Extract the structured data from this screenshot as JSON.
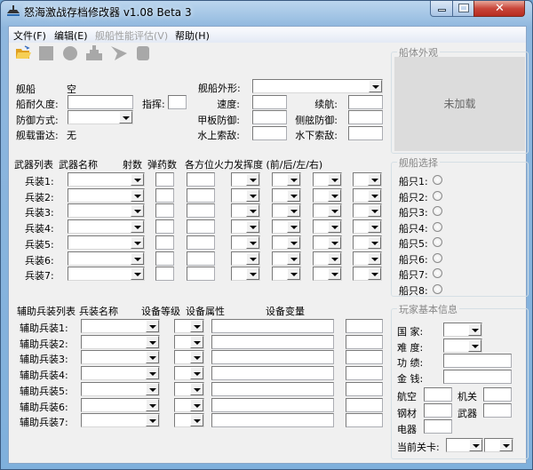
{
  "window": {
    "title": "怒海激战存档修改器 v1.08 Beta 3"
  },
  "menu": [
    {
      "label": "文件(F)",
      "enabled": true
    },
    {
      "label": "编辑(E)",
      "enabled": true
    },
    {
      "label": "舰船性能评估(V)",
      "enabled": false
    },
    {
      "label": "帮助(H)",
      "enabled": true
    }
  ],
  "toolbar": [
    "open-folder-icon",
    "square-icon",
    "circle-icon",
    "ship-icon",
    "plane-icon",
    "rounded-square-icon"
  ],
  "ship": {
    "ship_label": "舰船",
    "ship_value": "空",
    "durability_label": "船耐久度:",
    "command_label": "指挥:",
    "defense_mode_label": "防御方式:",
    "radar_label": "舰载雷达:",
    "radar_value": "无",
    "shape_label": "舰船外形:",
    "speed_label": "速度:",
    "range_label": "续航:",
    "deck_def_label": "甲板防御:",
    "side_def_label": "侧舷防御:",
    "surface_scan_label": "水上索敌:",
    "underwater_scan_label": "水下索敌:"
  },
  "weapons": {
    "headers": {
      "list": "武器列表",
      "name": "武器名称",
      "shots": "射数",
      "ammo": "弹药数",
      "arcs": "各方位火力发挥度 (前/后/左/右)"
    },
    "rows": [
      "兵装1:",
      "兵装2:",
      "兵装3:",
      "兵装4:",
      "兵装5:",
      "兵装6:",
      "兵装7:"
    ]
  },
  "aux": {
    "headers": {
      "list": "辅助兵装列表",
      "name": "兵装名称",
      "level": "设备等级",
      "attr": "设备属性",
      "var": "设备变量"
    },
    "rows": [
      "辅助兵装1:",
      "辅助兵装2:",
      "辅助兵装3:",
      "辅助兵装4:",
      "辅助兵装5:",
      "辅助兵装6:",
      "辅助兵装7:"
    ]
  },
  "appearance": {
    "title": "船体外观",
    "placeholder": "未加载"
  },
  "ship_select": {
    "title": "舰船选择",
    "items": [
      "船只1:",
      "船只2:",
      "船只3:",
      "船只4:",
      "船只5:",
      "船只6:",
      "船只7:",
      "船只8:"
    ]
  },
  "player": {
    "title": "玩家基本信息",
    "country": "国  家:",
    "difficulty": "难  度:",
    "merit": "功  绩:",
    "money": "金  钱:",
    "aviation": "航空",
    "machinery": "机关",
    "steel": "钢材",
    "weapons": "武器",
    "electrical": "电器",
    "current_stage": "当前关卡:"
  }
}
